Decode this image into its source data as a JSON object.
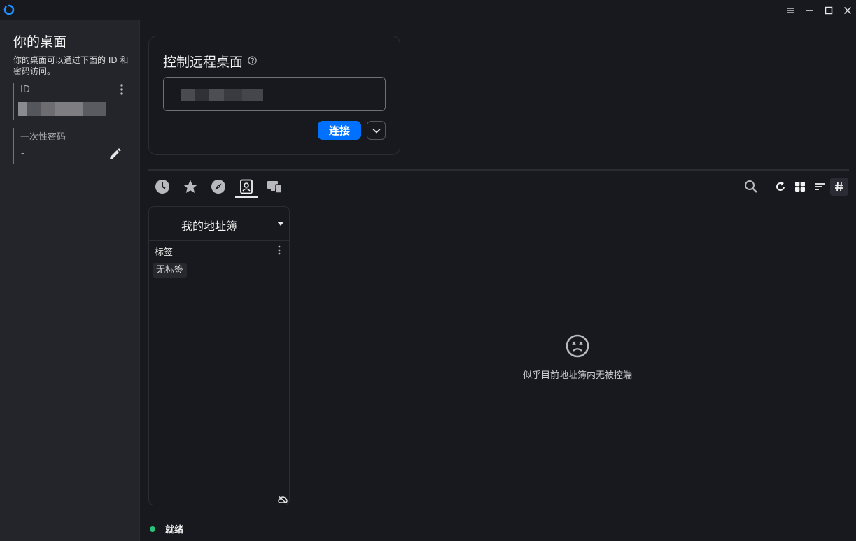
{
  "colors": {
    "accent": "#0071ff",
    "id_bar": "#2b7fff",
    "status_ok": "#2ac17a",
    "sidebar_bg": "#24252b",
    "main_bg": "#18191e"
  },
  "window": {
    "controls": [
      "menu-icon",
      "minimize-icon",
      "maximize-icon",
      "close-icon"
    ]
  },
  "sidebar": {
    "title": "你的桌面",
    "description": "你的桌面可以通过下面的 ID 和密码访问。",
    "id_label": "ID",
    "password_label": "一次性密码",
    "password_value": "-"
  },
  "remote": {
    "title": "控制远程桌面",
    "connect_label": "连接"
  },
  "tabs": [
    {
      "icon": "history-icon"
    },
    {
      "icon": "star-icon"
    },
    {
      "icon": "compass-icon"
    },
    {
      "icon": "address-book-icon",
      "active": true
    },
    {
      "icon": "devices-icon"
    }
  ],
  "toolbar": {
    "icons": [
      "search-icon",
      "refresh-icon",
      "grid-view-icon",
      "sort-icon",
      "hash-icon"
    ]
  },
  "address_book": {
    "name": "我的地址簿",
    "tags_label": "标签",
    "tags": [
      "无标签"
    ]
  },
  "empty_state": {
    "text": "似乎目前地址簿内无被控端"
  },
  "status": {
    "text": "就绪"
  }
}
